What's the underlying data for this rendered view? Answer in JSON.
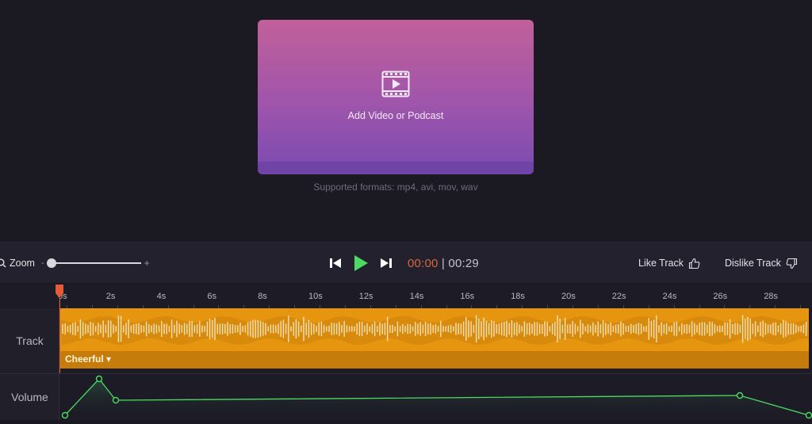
{
  "upload": {
    "label": "Add Video or Podcast",
    "formats": "Supported formats: mp4, avi, mov, wav",
    "icon": "video-film-icon"
  },
  "toolbar": {
    "zoom_label": "Zoom",
    "zoom_minus": "-",
    "zoom_plus": "+",
    "zoom_level": 0.0,
    "current_time": "00:00",
    "separator": "|",
    "total_time": "00:29",
    "like_label": "Like Track",
    "dislike_label": "Dislike Track"
  },
  "timeline": {
    "ticks": [
      "0s",
      "2s",
      "4s",
      "6s",
      "8s",
      "10s",
      "12s",
      "14s",
      "16s",
      "18s",
      "20s",
      "22s",
      "24s",
      "26s",
      "28s"
    ],
    "track_label": "Track",
    "volume_label": "Volume",
    "clip_mood": "Cheerful",
    "clip_mood_chevron": "▾"
  },
  "colors": {
    "accent_play": "#4cd964",
    "current_time": "#d5673f",
    "clip": "#e6950f",
    "volume_line": "#4cd964",
    "playhead": "#e35b3a"
  }
}
